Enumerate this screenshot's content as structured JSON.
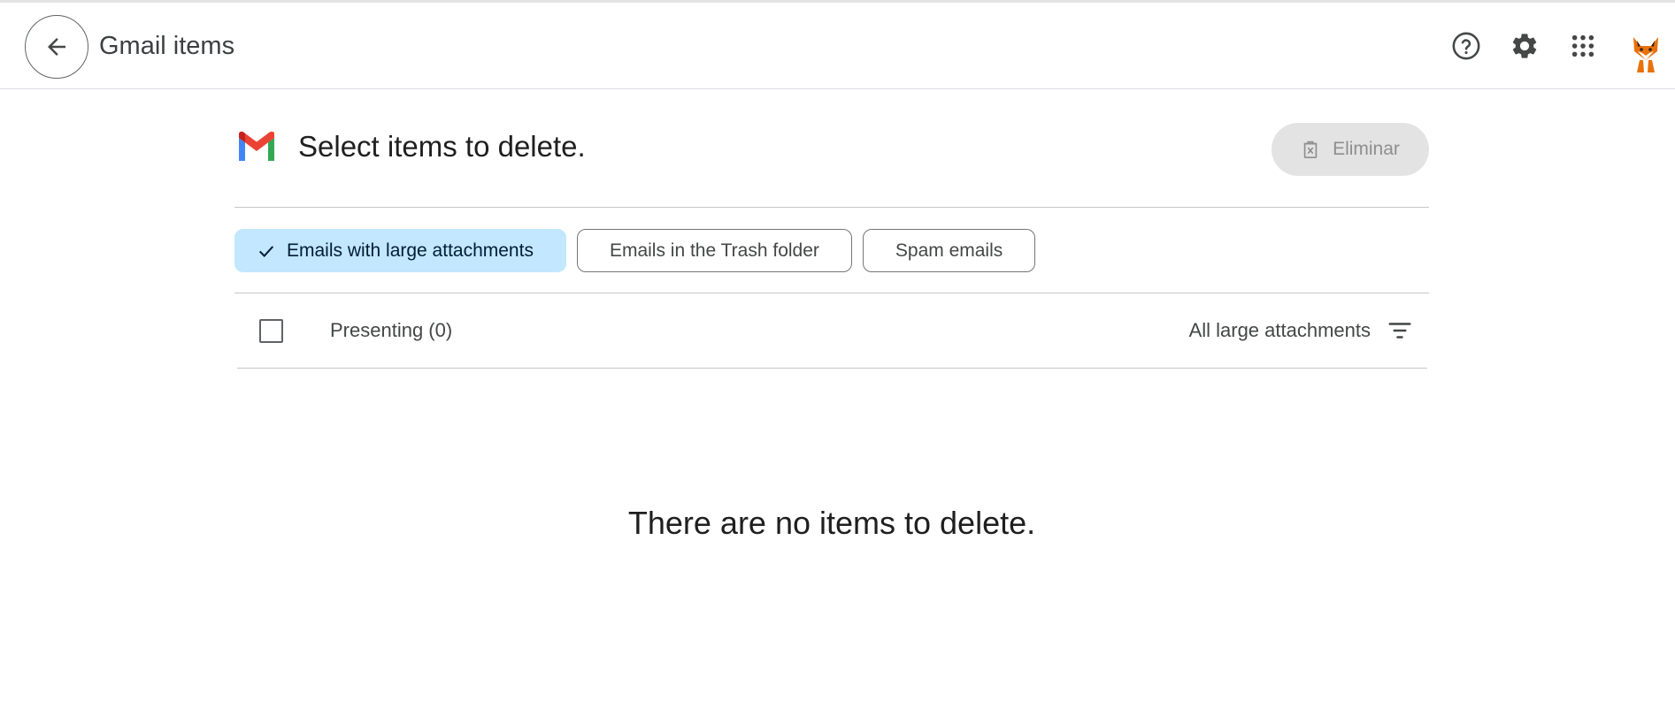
{
  "header": {
    "title": "Gmail items",
    "icons": {
      "back": "arrow-left-icon",
      "help": "help-circle-icon",
      "settings": "gear-icon",
      "apps": "apps-grid-icon",
      "avatar": "fox-avatar"
    }
  },
  "main": {
    "title": "Select items to delete.",
    "delete_label": "Eliminar",
    "delete_icon": "delete-box-icon",
    "chips": [
      {
        "label": "Emails with large attachments",
        "selected": true
      },
      {
        "label": "Emails in the Trash folder",
        "selected": false
      },
      {
        "label": "Spam emails",
        "selected": false
      }
    ],
    "list": {
      "presenting_label": "Presenting (0)",
      "filter_label": "All large attachments",
      "filter_icon": "filter-list-icon"
    },
    "empty_message": "There are no items to delete."
  },
  "colors": {
    "selected_chip": "#c2e7ff",
    "disabled_button": "#e3e3e3",
    "gmail_red": "#ea4335",
    "gmail_blue": "#4285f4",
    "gmail_green": "#34a853",
    "gmail_yellow": "#fbbc04"
  }
}
